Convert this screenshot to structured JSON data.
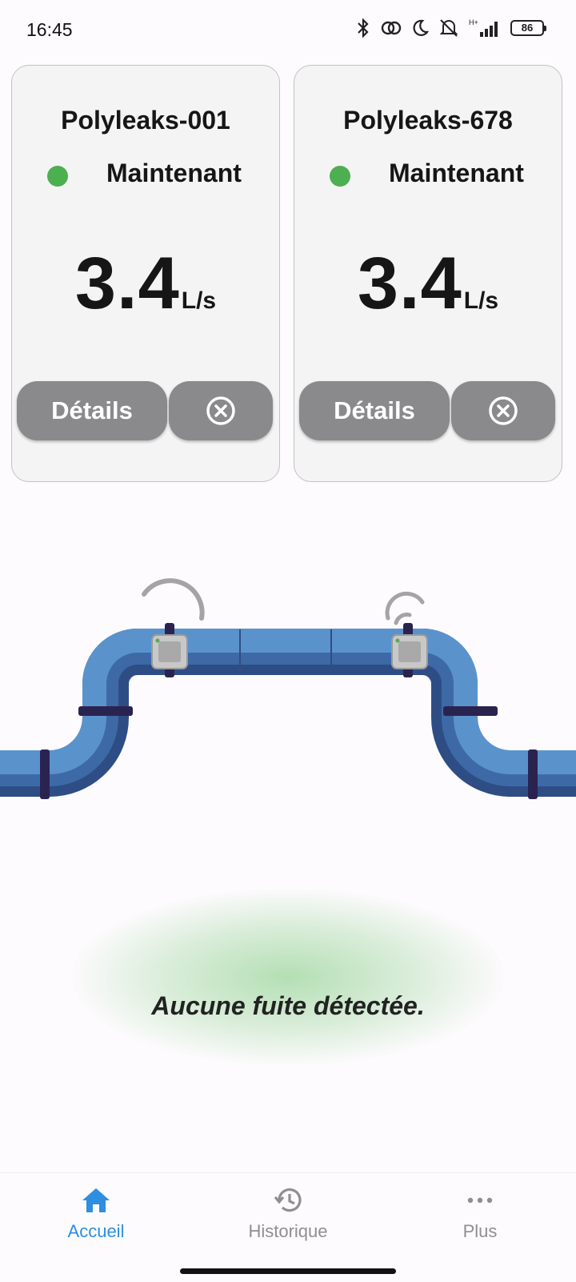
{
  "status_bar": {
    "time": "16:45",
    "battery": "86",
    "network": "H+",
    "icons": [
      "bluetooth-icon",
      "link-icon",
      "moon-icon",
      "mute-icon",
      "signal-icon",
      "battery-icon"
    ]
  },
  "devices": [
    {
      "name": "Polyleaks-001",
      "status": "Maintenant",
      "flow_value": "3.4",
      "flow_unit": "L/s",
      "details_label": "Détails"
    },
    {
      "name": "Polyleaks-678",
      "status": "Maintenant",
      "flow_value": "3.4",
      "flow_unit": "L/s",
      "details_label": "Détails"
    }
  ],
  "message": "Aucune fuite détectée.",
  "nav": {
    "home": "Accueil",
    "history": "Historique",
    "more": "Plus"
  },
  "colors": {
    "accent": "#2e8ee0",
    "status_ok": "#4caf50",
    "button": "#8a8a8c",
    "pipe_main": "#4f86bf",
    "pipe_dark": "#2f4f86"
  }
}
